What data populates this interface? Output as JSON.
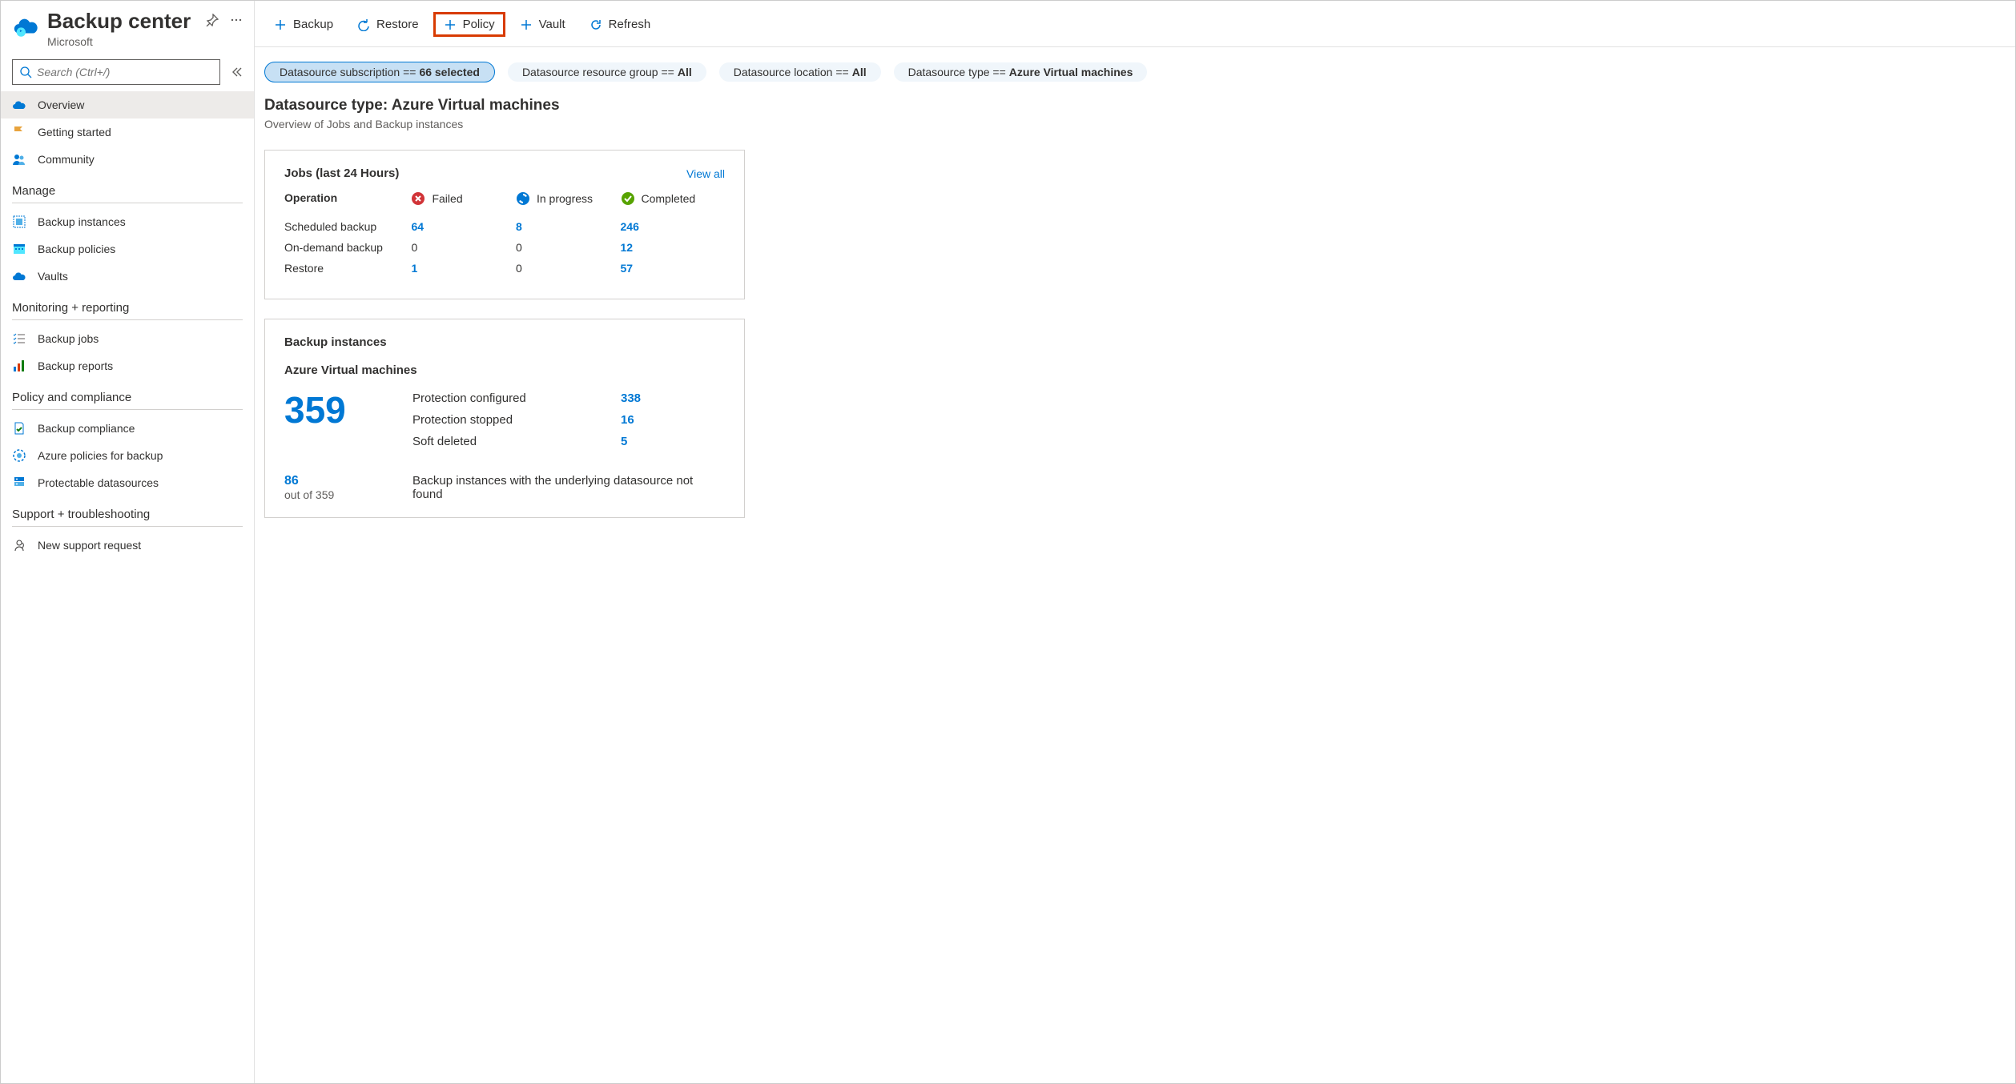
{
  "header": {
    "title": "Backup center",
    "subtitle": "Microsoft"
  },
  "sidebar": {
    "search_placeholder": "Search (Ctrl+/)",
    "items_top": [
      {
        "label": "Overview",
        "icon": "cloud"
      },
      {
        "label": "Getting started",
        "icon": "flag"
      },
      {
        "label": "Community",
        "icon": "people"
      }
    ],
    "sections": [
      {
        "title": "Manage",
        "items": [
          {
            "label": "Backup instances",
            "icon": "instances"
          },
          {
            "label": "Backup policies",
            "icon": "calendar"
          },
          {
            "label": "Vaults",
            "icon": "cloud2"
          }
        ]
      },
      {
        "title": "Monitoring + reporting",
        "items": [
          {
            "label": "Backup jobs",
            "icon": "checklist"
          },
          {
            "label": "Backup reports",
            "icon": "barchart"
          }
        ]
      },
      {
        "title": "Policy and compliance",
        "items": [
          {
            "label": "Backup compliance",
            "icon": "doc-check"
          },
          {
            "label": "Azure policies for backup",
            "icon": "gear-ring"
          },
          {
            "label": "Protectable datasources",
            "icon": "server"
          }
        ]
      },
      {
        "title": "Support + troubleshooting",
        "items": [
          {
            "label": "New support request",
            "icon": "support"
          }
        ]
      }
    ]
  },
  "toolbar": {
    "backup": "Backup",
    "restore": "Restore",
    "policy": "Policy",
    "vault": "Vault",
    "refresh": "Refresh"
  },
  "filters": {
    "subscription": {
      "label": "Datasource subscription == ",
      "value": "66 selected"
    },
    "resource_group": {
      "label": "Datasource resource group == ",
      "value": "All"
    },
    "location": {
      "label": "Datasource location == ",
      "value": "All"
    },
    "type": {
      "label": "Datasource type == ",
      "value": "Azure Virtual machines"
    }
  },
  "content": {
    "title": "Datasource type: Azure Virtual machines",
    "subtitle": "Overview of Jobs and Backup instances"
  },
  "jobs_card": {
    "title": "Jobs (last 24 Hours)",
    "view_all": "View all",
    "header": {
      "op": "Operation",
      "failed": "Failed",
      "inprogress": "In progress",
      "completed": "Completed"
    },
    "rows": [
      {
        "op": "Scheduled backup",
        "failed": "64",
        "failed_link": true,
        "inprogress": "8",
        "inprogress_link": true,
        "completed": "246"
      },
      {
        "op": "On-demand backup",
        "failed": "0",
        "failed_link": false,
        "inprogress": "0",
        "inprogress_link": false,
        "completed": "12"
      },
      {
        "op": "Restore",
        "failed": "1",
        "failed_link": true,
        "inprogress": "0",
        "inprogress_link": false,
        "completed": "57"
      }
    ]
  },
  "instances_card": {
    "title": "Backup instances",
    "subtitle": "Azure Virtual machines",
    "total": "359",
    "stats": [
      {
        "label": "Protection configured",
        "value": "338"
      },
      {
        "label": "Protection stopped",
        "value": "16"
      },
      {
        "label": "Soft deleted",
        "value": "5"
      }
    ],
    "footer": {
      "count": "86",
      "sub": "out of 359",
      "text": "Backup instances with the underlying datasource not found"
    }
  }
}
